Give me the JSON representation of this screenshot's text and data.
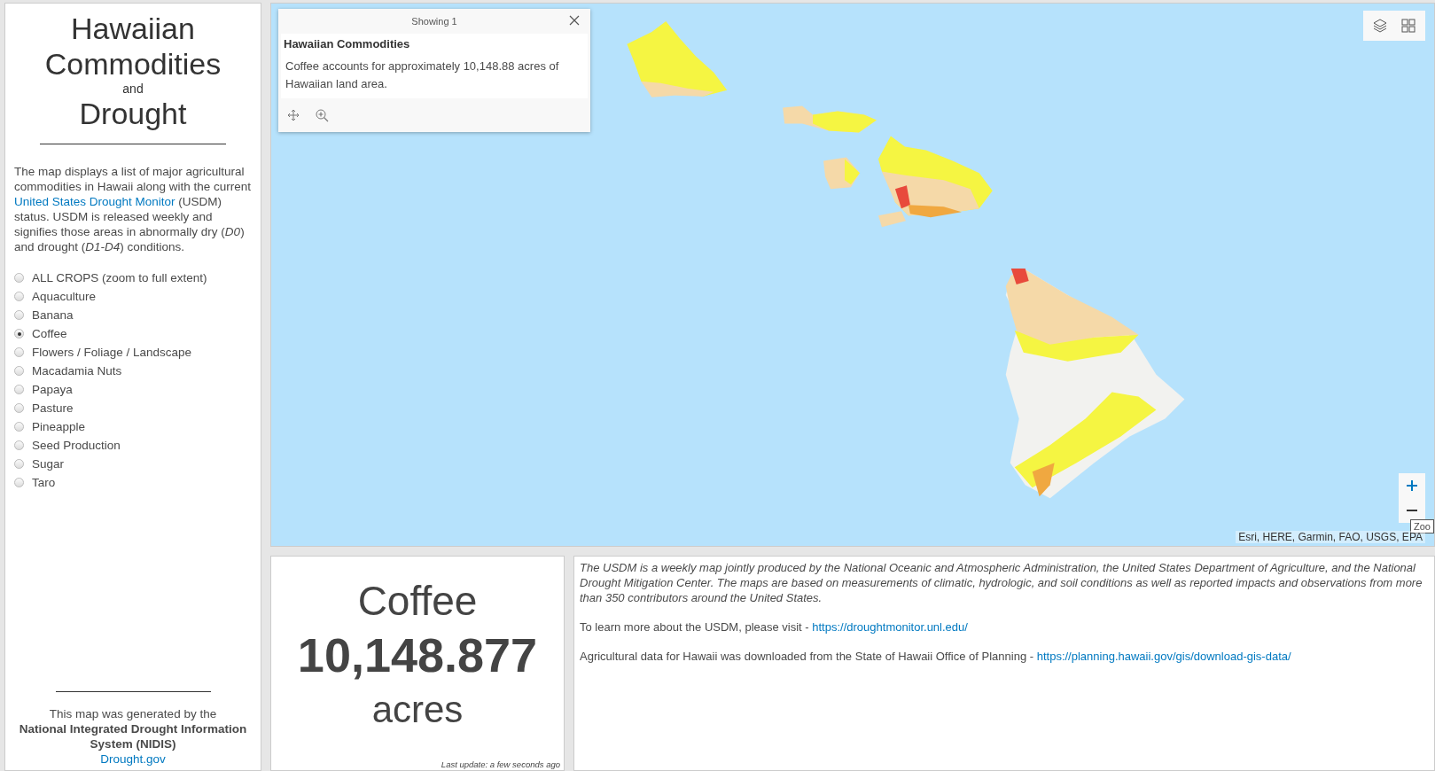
{
  "sidebar": {
    "title_lines": [
      "Hawaiian",
      "Commodities"
    ],
    "joiner": "and",
    "title_last": "Drought",
    "intro": {
      "before": "The map displays a list of major agricultural commodities in Hawaii along with the current ",
      "link": "United States Drought Monitor",
      "after": " (USDM) status. USDM is released weekly and signifies those areas in abnormally dry (*D0*) and drought (*D1-D4*) conditions."
    },
    "crops": [
      {
        "label": "ALL CROPS (zoom to full extent)",
        "selected": false
      },
      {
        "label": "Aquaculture",
        "selected": false
      },
      {
        "label": "Banana",
        "selected": false
      },
      {
        "label": "Coffee",
        "selected": true
      },
      {
        "label": "Flowers / Foliage / Landscape",
        "selected": false
      },
      {
        "label": "Macadamia Nuts",
        "selected": false
      },
      {
        "label": "Papaya",
        "selected": false
      },
      {
        "label": "Pasture",
        "selected": false
      },
      {
        "label": "Pineapple",
        "selected": false
      },
      {
        "label": "Seed Production",
        "selected": false
      },
      {
        "label": "Sugar",
        "selected": false
      },
      {
        "label": "Taro",
        "selected": false
      }
    ],
    "footer": {
      "lead": "This map was generated by the",
      "org": "National Integrated Drought Information System (NIDIS)",
      "link": "Drought.gov"
    }
  },
  "map": {
    "popup": {
      "header": "Showing 1",
      "title": "Hawaiian Commodities",
      "body": "Coffee accounts for approximately 10,148.88 acres of Hawaiian land area."
    },
    "tooltip": "Zoo",
    "attribution": "Esri, HERE, Garmin, FAO, USGS, EPA"
  },
  "summary_card": {
    "name": "Coffee",
    "value": "10,148.877",
    "unit": "acres",
    "updated": "Last update: a few seconds ago"
  },
  "about": {
    "paragraph": "The USDM is a weekly map jointly produced by the National Oceanic and Atmospheric Administration, the United States Department of Agriculture, and the National Drought Mitigation Center. The maps are based on measurements of climatic, hydrologic, and soil conditions as well as reported impacts and observations from more than 350 contributors around the United States.",
    "visit_text": "To learn more about the USDM, please visit - ",
    "visit_link": "https://droughtmonitor.unl.edu/",
    "data_text": "Agricultural data for Hawaii was downloaded from the State of Hawaii Office of Planning - ",
    "data_link": "https://planning.hawaii.gov/gis/download-gis-data/"
  }
}
